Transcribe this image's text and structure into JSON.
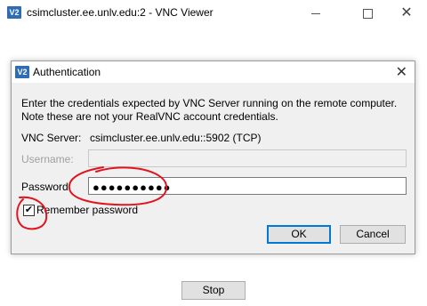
{
  "app": {
    "window_title": "csimcluster.ee.unlv.edu:2 - VNC Viewer",
    "logo_text": "V2"
  },
  "dialog": {
    "title": "Authentication",
    "description_line1": "Enter the credentials expected by VNC Server running on the remote computer.",
    "description_line2": "Note these are not your RealVNC account credentials.",
    "server_label": "VNC Server:",
    "server_value": "csimcluster.ee.unlv.edu::5902 (TCP)",
    "username_label": "Username:",
    "username_value": "",
    "password_label": "Password:",
    "password_mask": "●●●●●●●●●●",
    "remember_label": "Remember password",
    "remember_checked": true,
    "ok_label": "OK",
    "cancel_label": "Cancel"
  },
  "footer": {
    "stop_label": "Stop"
  },
  "colors": {
    "dialog_bg": "#f0f0f0",
    "button_bg": "#e1e1e1",
    "default_button_border": "#0078d7",
    "logo_bg": "#2e6cb6",
    "annotation_red": "#e0141e"
  }
}
